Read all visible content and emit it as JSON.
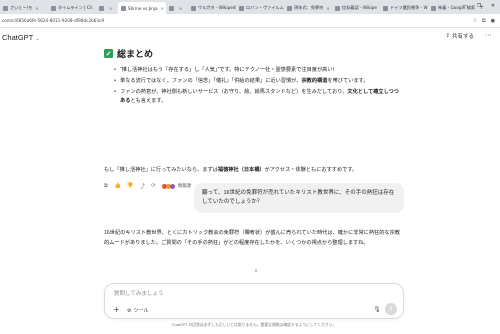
{
  "browser": {
    "tabs": [
      {
        "label": "さいとー/モ",
        "active": false
      },
      {
        "label": "タイムライン | Ch",
        "active": false
      },
      {
        "label": "",
        "active": false
      },
      {
        "label": "Shrine vs Jinja",
        "active": true
      },
      {
        "label": "",
        "active": false
      },
      {
        "label": "ウルガタ - Wikipedia",
        "active": false
      },
      {
        "label": "ロバン・ヴァイルム - W",
        "active": false
      },
      {
        "label": "現年式：免罪符",
        "active": false
      },
      {
        "label": "信仰義認 - Wikipe",
        "active": false
      },
      {
        "label": "ドイツ農民戦争 - W",
        "active": false
      },
      {
        "label": "神義 - Google 検索",
        "active": false
      }
    ],
    "new_tab": "+",
    "window_controls": [
      "—",
      "❐",
      "✕"
    ],
    "url": "com/c/6856a6fe-5624-8011-9208-df98dc2b63c9"
  },
  "app": {
    "model_label": "ChatGPT",
    "model_chevron": "⌄",
    "share_label": "共有する",
    "more_icon": "⋯"
  },
  "summary": {
    "check": "✓",
    "title": "総まとめ",
    "bullets": [
      {
        "pre": "“推し活神社はもう「存在する」し「人気」”です。特にテクノ一社・霊感要素で注目度が高い！",
        "bold": "",
        "post": ""
      },
      {
        "pre": "単なる流行ではなく、ファンの「信念」「儀礼」「供給の結果」に近い習慣が、",
        "bold": "宗教的構造",
        "post": "を帯びています。"
      },
      {
        "pre": "ファンの熱意が、神社側も新しいサービス（お守り、絵、絵馬スタンドなど）を生みだしており、",
        "bold": "文化として確立しつつある",
        "post": "とも言えます。"
      }
    ],
    "closing_pre": "もし「推し活神社」に行ってみたいなら、まずは",
    "closing_bold": "福徳神社（日本橋）",
    "closing_post": "がアクセス・体験ともにおすすめです。"
  },
  "actions": {
    "icons": [
      "⧉",
      "👍",
      "👎",
      "⤴",
      "⟳"
    ],
    "source_label": "情報源",
    "source_dots": [
      "#e74c3c",
      "#f39c12",
      "#9b59b6"
    ]
  },
  "user_message": "翻って、16世紀の免罪符が売れていたキリスト教世界に、その手の熱狂は存在していたのでしょうか？",
  "answer": "16世紀のキリスト教世界、とくにカトリック教会の免罪符（贖宥状）が盛んに売られていた時代は、確かに非常に熱狂的な宗教的ムードがありました。ご質問の「その手の熱狂」がどの程度存在したかを、いくつかの視点から整理しますね。",
  "composer": {
    "placeholder": "質問してみましょう",
    "plus": "+",
    "tools_label": "ツール",
    "mic_icon": "🎙",
    "send_icon": "↑"
  },
  "disclaimer": "ChatGPT の回答は必ずしも正しいとは限りません。重要な情報は確認するようにしてください。",
  "scroll_icon": "↓"
}
